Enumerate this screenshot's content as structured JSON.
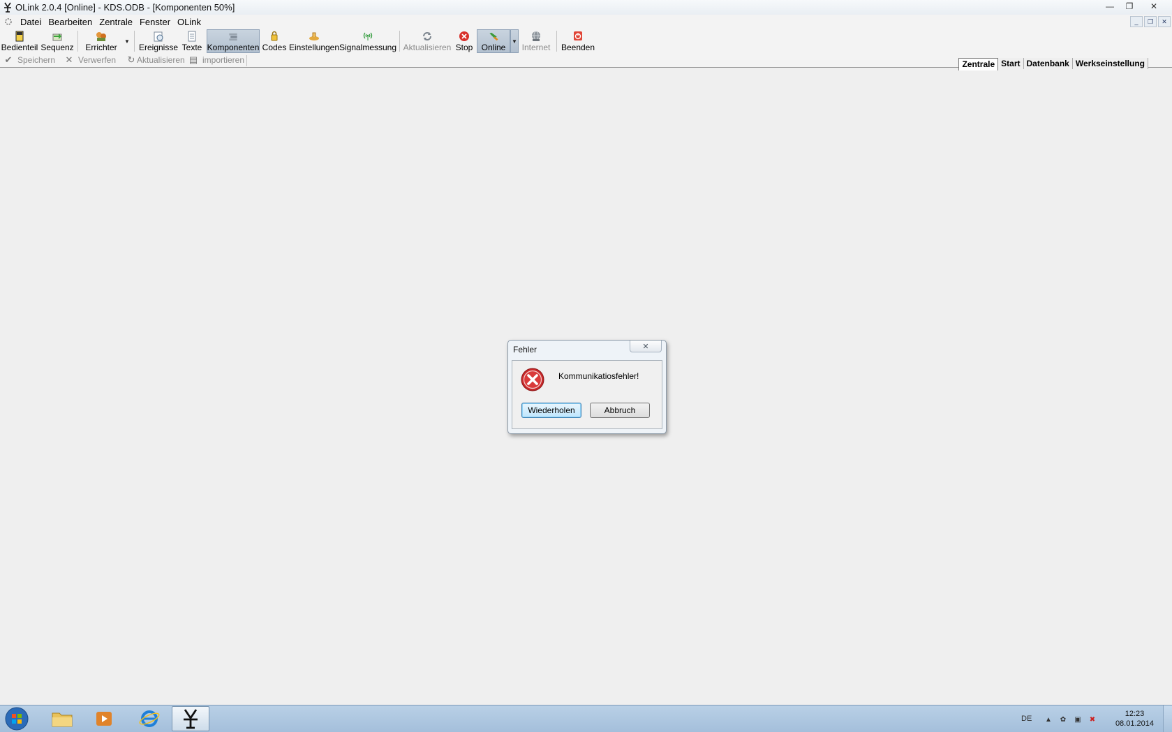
{
  "window": {
    "title": "OLink 2.0.4 [Online] - KDS.ODB - [Komponenten 50%]",
    "controls": {
      "minimize": "—",
      "restore": "❐",
      "close": "✕"
    }
  },
  "menu": {
    "items": [
      "Datei",
      "Bearbeiten",
      "Zentrale",
      "Fenster",
      "OLink"
    ]
  },
  "toolbar": {
    "buttons": [
      {
        "label": "Bedienteil",
        "icon": "keypad-icon"
      },
      {
        "label": "Sequenz",
        "icon": "sequence-icon"
      },
      {
        "label": "Errichter",
        "icon": "installer-icon"
      },
      {
        "label": "Ereignisse",
        "icon": "events-icon"
      },
      {
        "label": "Texte",
        "icon": "texts-icon"
      },
      {
        "label": "Komponenten",
        "icon": "components-icon",
        "active": true
      },
      {
        "label": "Codes",
        "icon": "codes-icon"
      },
      {
        "label": "Einstellungen",
        "icon": "settings-icon"
      },
      {
        "label": "Signalmessung",
        "icon": "signal-icon"
      },
      {
        "label": "Aktualisieren",
        "icon": "refresh-icon",
        "disabled": true
      },
      {
        "label": "Stop",
        "icon": "stop-icon"
      },
      {
        "label": "Online",
        "icon": "online-icon",
        "active": true
      },
      {
        "label": "Internet",
        "icon": "internet-icon",
        "disabled": true
      },
      {
        "label": "Beenden",
        "icon": "power-icon"
      }
    ]
  },
  "toolbar2": {
    "buttons": [
      {
        "label": "Speichern",
        "glyph": "✔"
      },
      {
        "label": "Verwerfen",
        "glyph": "✕"
      },
      {
        "label": "Aktualisieren",
        "glyph": "↻"
      },
      {
        "label": "importieren",
        "glyph": "▤"
      }
    ]
  },
  "tabs": [
    "Zentrale",
    "Start",
    "Datenbank",
    "Werkseinstellung"
  ],
  "dialog": {
    "title": "Fehler",
    "close_glyph": "✕",
    "message": "Kommunikatiosfehler!",
    "retry_label": "Wiederholen",
    "cancel_label": "Abbruch"
  },
  "tray": {
    "language": "DE",
    "time": "12:23",
    "date": "08.01.2014"
  },
  "colors": {
    "error_red": "#c8282a",
    "active_toolbar": "#b8c6d4",
    "taskbar": "#b2cbe2"
  }
}
